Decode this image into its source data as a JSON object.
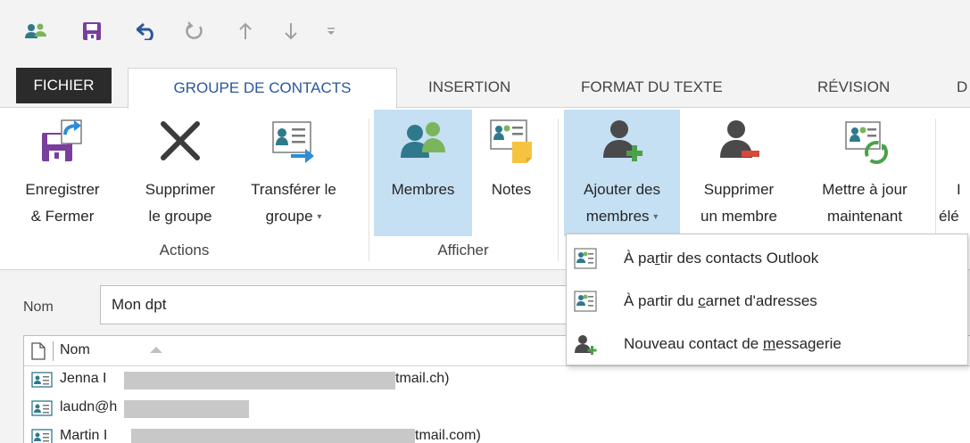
{
  "qat": {
    "icons": [
      "contact-group-icon",
      "save-icon",
      "undo-icon",
      "redo-icon",
      "move-up-icon",
      "move-down-icon",
      "customize-icon"
    ]
  },
  "tabs": [
    {
      "label": "FICHIER"
    },
    {
      "label": "GROUPE DE CONTACTS"
    },
    {
      "label": "INSERTION"
    },
    {
      "label": "FORMAT DU TEXTE"
    },
    {
      "label": "RÉVISION"
    },
    {
      "label": "D"
    }
  ],
  "ribbon": {
    "actions": {
      "group_label": "Actions",
      "save_close": {
        "line1": "Enregistrer",
        "line2": "& Fermer"
      },
      "delete_group": {
        "line1": "Supprimer",
        "line2": "le groupe"
      },
      "forward_group": {
        "line1": "Transférer le",
        "line2": "groupe"
      }
    },
    "show": {
      "group_label": "Afficher",
      "members": {
        "line1": "Membres"
      },
      "notes": {
        "line1": "Notes"
      }
    },
    "members_group": {
      "add_members": {
        "line1": "Ajouter des",
        "line2": "membres"
      },
      "remove_member": {
        "line1": "Supprimer",
        "line2": "un membre"
      },
      "update_now": {
        "line1": "Mettre à jour",
        "line2": "maintenant"
      },
      "next_partial": {
        "line1": "I",
        "line2": "élé"
      }
    }
  },
  "menu": {
    "items": [
      {
        "pre": "À pa",
        "ul": "r",
        "post": "tir des contacts Outlook"
      },
      {
        "pre": "À partir du ",
        "ul": "c",
        "post": "arnet d'adresses"
      },
      {
        "pre": "Nouveau contact de ",
        "ul": "m",
        "post": "essagerie"
      }
    ]
  },
  "form": {
    "name_label": "Nom",
    "name_value": "Mon dpt",
    "column_header": "Nom",
    "rows": [
      {
        "start": "Jenna I",
        "end": "tmail.ch)"
      },
      {
        "start": "laudn@h",
        "end": ""
      },
      {
        "start": "Martin I",
        "end": "tmail.com)"
      }
    ]
  },
  "colors": {
    "accent": "#2b579a",
    "highlight": "#c5dff3",
    "save_purple": "#7a3e9d",
    "people_teal": "#2e7a8c",
    "people_green": "#7ab55c"
  }
}
